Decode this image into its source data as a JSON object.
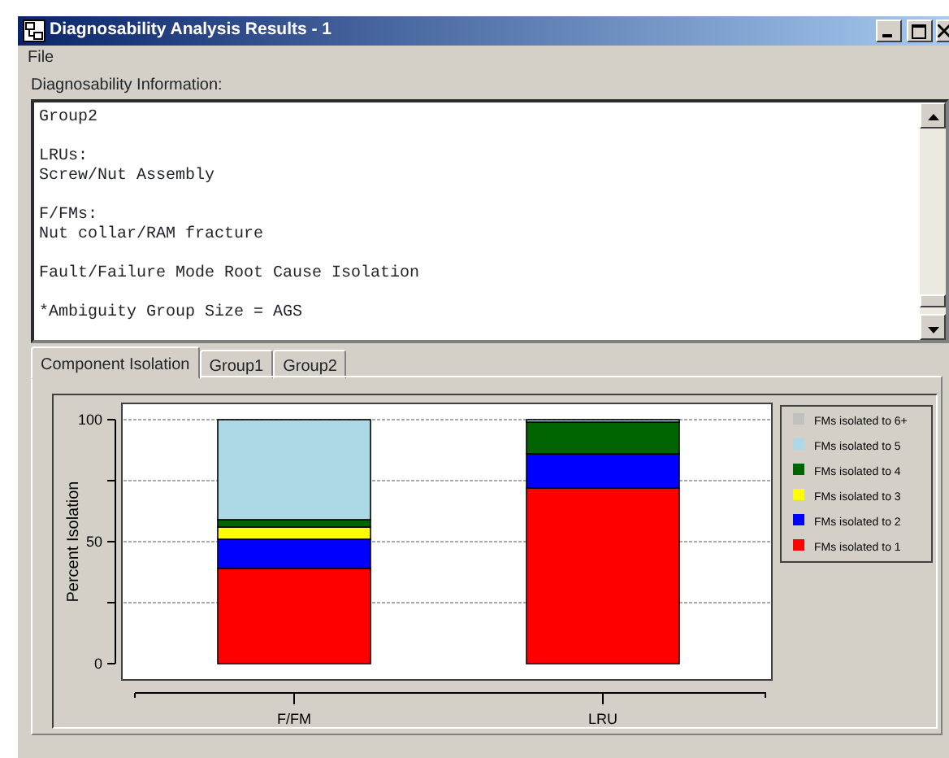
{
  "window": {
    "title": "Diagnosability Analysis Results - 1"
  },
  "menu": [
    {
      "label": "File"
    }
  ],
  "info": {
    "label": "Diagnosability Information:",
    "blocks": [
      [
        "Group2"
      ],
      [
        "LRUs:",
        "Screw/Nut Assembly"
      ],
      [
        "F/FMs:",
        "Nut collar/RAM fracture"
      ],
      [
        "Fault/Failure Mode Root Cause Isolation"
      ],
      [
        "*Ambiguity Group Size = AGS"
      ]
    ]
  },
  "tabs": [
    {
      "label": "Component Isolation",
      "selected": true
    },
    {
      "label": "Group1",
      "selected": false
    },
    {
      "label": "Group2",
      "selected": false
    }
  ],
  "chart_data": {
    "type": "bar",
    "stacked": true,
    "legend": true,
    "ylabel": "Percent Isolation",
    "categories": [
      "F/FM",
      "LRU"
    ],
    "ylim": [
      0,
      100
    ],
    "yticks": [
      0,
      50,
      100
    ],
    "series": [
      {
        "name": "FMs isolated to 1",
        "color": "#ff0000",
        "values": [
          39,
          72
        ]
      },
      {
        "name": "FMs isolated to 2",
        "color": "#0000ff",
        "values": [
          12,
          14
        ]
      },
      {
        "name": "FMs isolated to 3",
        "color": "#ffff00",
        "values": [
          5,
          0
        ]
      },
      {
        "name": "FMs isolated to 4",
        "color": "#006400",
        "values": [
          3,
          13
        ]
      },
      {
        "name": "FMs isolated to 5",
        "color": "#add8e6",
        "values": [
          41,
          1
        ]
      },
      {
        "name": "FMs isolated to 6+",
        "color": "#c0c0c0",
        "values": [
          0,
          0
        ]
      }
    ]
  }
}
